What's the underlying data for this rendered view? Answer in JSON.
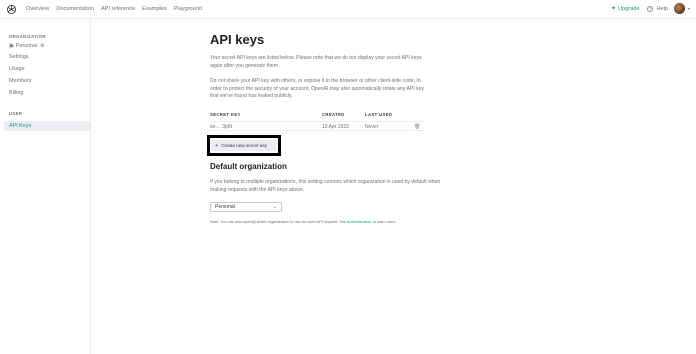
{
  "topbar": {
    "nav": [
      "Overview",
      "Documentation",
      "API reference",
      "Examples",
      "Playground"
    ],
    "upgrade_label": "Upgrade",
    "help_label": "Help"
  },
  "sidebar": {
    "org_heading": "ORGANIZATION",
    "org_items": [
      "Personal",
      "Settings",
      "Usage",
      "Members",
      "Billing"
    ],
    "user_heading": "USER",
    "user_items": [
      "API Keys"
    ]
  },
  "main": {
    "title": "API keys",
    "intro": "Your secret API keys are listed below. Please note that we do not display your secret API keys again after you generate them.",
    "warning": "Do not share your API key with others, or expose it in the browser or other client-side code. In order to protect the security of your account, OpenAI may also automatically rotate any API key that we've found has leaked publicly.",
    "table": {
      "headers": [
        "SECRET KEY",
        "CREATED",
        "LAST USED"
      ],
      "rows": [
        {
          "key": "sk-...  3p0t",
          "created": "13 Apr 2023",
          "last_used": "Never"
        }
      ]
    },
    "create_button": "Create new secret key",
    "default_org": {
      "heading": "Default organization",
      "description": "If you belong to multiple organizations, this setting controls which organization is used by default when making requests with the API keys above.",
      "selected": "Personal",
      "note_prefix": "Note: You can also specify which organization to use for each API request. See ",
      "note_link": "Authentication",
      "note_suffix": " to learn more."
    }
  },
  "colors": {
    "accent": "#10a37f",
    "text": "#353740",
    "muted": "#6e6e80",
    "border": "#ececf1",
    "highlight_box": "#000000"
  }
}
